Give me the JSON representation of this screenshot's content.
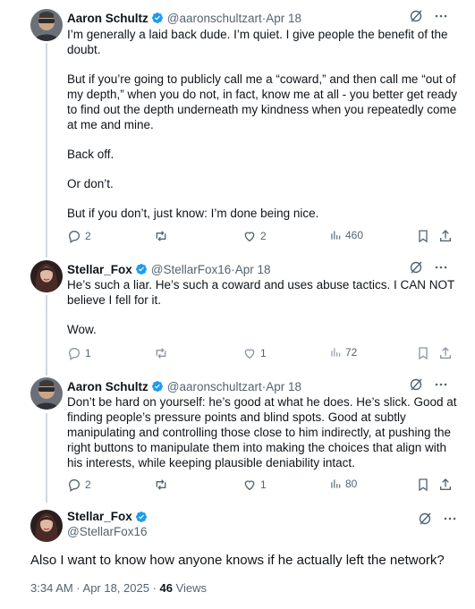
{
  "tweets": [
    {
      "name": "Aaron Schultz",
      "handle": "@aaronschultzart",
      "date": "Apr 18",
      "paragraphs": [
        "I’m generally a laid back dude. I’m quiet. I give people the benefit of the doubt.",
        "But if you’re going to publicly call me a “coward,” and then call me “out of my depth,” when you do not, in fact, know me at all - you better get ready to find out the depth underneath my kindness when you repeatedly come at me and mine.",
        "Back off.",
        "Or don’t.",
        "But if you don’t, just know: I’m done being nice."
      ],
      "replies": "2",
      "reposts": "",
      "likes": "2",
      "views": "460"
    },
    {
      "name": "Stellar_Fox",
      "handle": "@StellarFox16",
      "date": "Apr 18",
      "paragraphs": [
        "He’s such a liar. He’s such a coward and uses abuse tactics. I CAN NOT believe I fell for it.",
        "Wow."
      ],
      "replies": "1",
      "reposts": "",
      "likes": "1",
      "views": "72"
    },
    {
      "name": "Aaron Schultz",
      "handle": "@aaronschultzart",
      "date": "Apr 18",
      "paragraphs": [
        "Don’t be hard on yourself: he’s good at what he does. He’s slick. Good at finding people’s pressure points and blind spots. Good at subtly manipulating and controlling those close to him indirectly, at pushing the right buttons to manipulate them into making the choices that align with his interests, while keeping plausible deniability intact."
      ],
      "replies": "2",
      "reposts": "",
      "likes": "1",
      "views": "80"
    }
  ],
  "main_tweet": {
    "name": "Stellar_Fox",
    "handle": "@StellarFox16",
    "text": "Also I want to know how anyone knows if he actually left the network?",
    "timestamp": "3:34 AM · Apr 18, 2025 · ",
    "views_count": "46",
    "views_label": " Views"
  },
  "header_separator": " · ",
  "icons": {
    "verified": "verified-badge-icon",
    "grok": "grok-icon",
    "more": "more-icon",
    "reply": "reply-icon",
    "repost": "repost-icon",
    "like": "like-icon",
    "views": "views-icon",
    "bookmark": "bookmark-icon",
    "share": "share-icon"
  },
  "colors": {
    "verified": "#1d9bf0",
    "text": "#0f1419",
    "secondary": "#536471",
    "thread_line": "#cfd9de"
  }
}
